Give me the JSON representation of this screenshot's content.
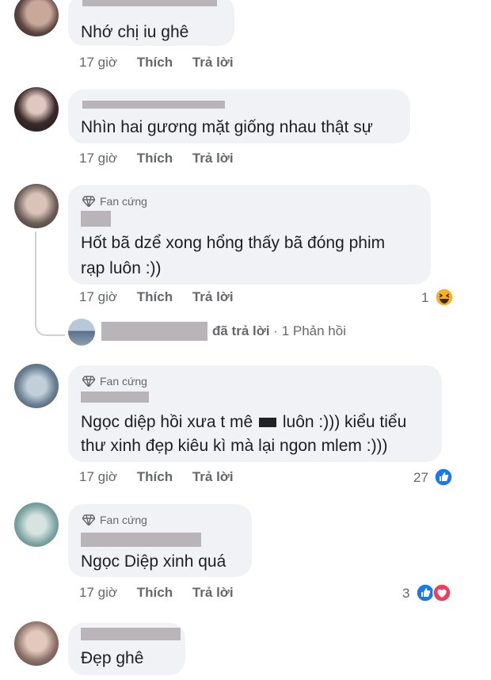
{
  "comments": [
    {
      "text": "Nhớ chị iu ghê",
      "time": "17 giờ",
      "like": "Thích",
      "reply": "Trả lời"
    },
    {
      "text": "Nhìn hai gương mặt giống nhau thật sự",
      "time": "17 giờ",
      "like": "Thích",
      "reply": "Trả lời"
    },
    {
      "badge": "Fan cứng",
      "text_line1": "Hốt bã dzể xong hổng thấy bã đóng phim",
      "text_line2": "rạp luôn :))",
      "time": "17 giờ",
      "like": "Thích",
      "reply": "Trả lời",
      "reaction_count": "1"
    },
    {
      "badge": "Fan cứng",
      "text_line1_a": "Ngọc diệp hồi xưa t mê",
      "text_line1_b": "luôn :))) kiểu tiểu",
      "text_line2": "thư xinh đẹp kiêu kì mà lại ngon mlem :)))",
      "time": "17 giờ",
      "like": "Thích",
      "reply": "Trả lời",
      "reaction_count": "27"
    },
    {
      "badge": "Fan cứng",
      "text": "Ngọc Diệp xinh quá",
      "time": "17 giờ",
      "like": "Thích",
      "reply": "Trả lời",
      "reaction_count": "3"
    },
    {
      "text": "Đẹp ghê"
    }
  ],
  "reply_summary": {
    "replied": "đã trả lời",
    "separator": "·",
    "count": "1 Phản hồi"
  },
  "colors": {
    "bubble": "#f0f2f5",
    "meta": "#65676b",
    "like_blue": "#1877f2",
    "love_red": "#f33e58",
    "haha_yellow": "#f7b125"
  }
}
